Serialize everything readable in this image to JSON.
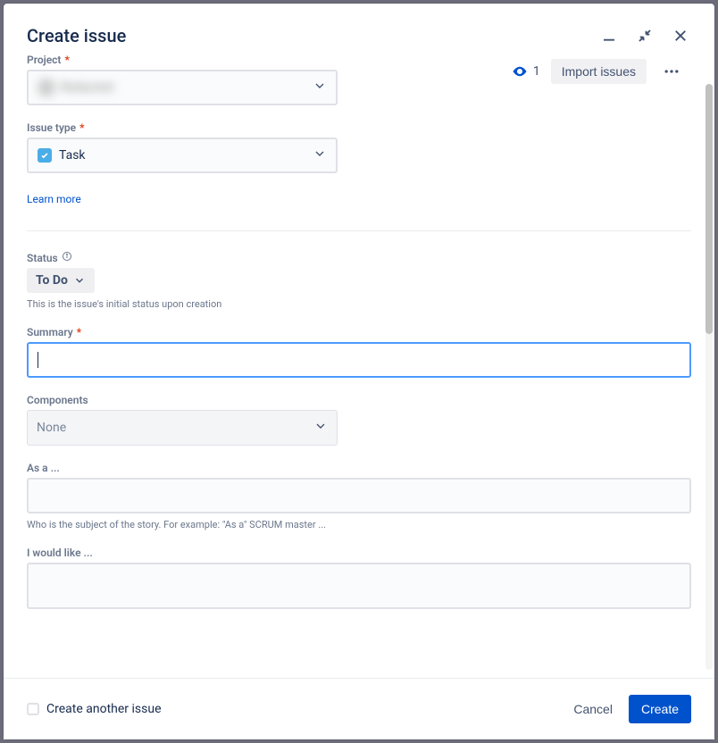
{
  "header": {
    "title": "Create issue"
  },
  "toolbar": {
    "watcher_count": "1",
    "import_label": "Import issues"
  },
  "fields": {
    "project": {
      "label": "Project",
      "value": "Redacted"
    },
    "issue_type": {
      "label": "Issue type",
      "value": "Task"
    },
    "learn_more": "Learn more",
    "status": {
      "label": "Status",
      "value": "To Do",
      "help": "This is the issue's initial status upon creation"
    },
    "summary": {
      "label": "Summary",
      "value": ""
    },
    "components": {
      "label": "Components",
      "placeholder": "None"
    },
    "as_a": {
      "label": "As a ...",
      "help": "Who is the subject of the story.  For example:  \"As a\" SCRUM master ..."
    },
    "i_would_like": {
      "label": "I would like ..."
    }
  },
  "footer": {
    "create_another": "Create another issue",
    "cancel": "Cancel",
    "create": "Create"
  }
}
